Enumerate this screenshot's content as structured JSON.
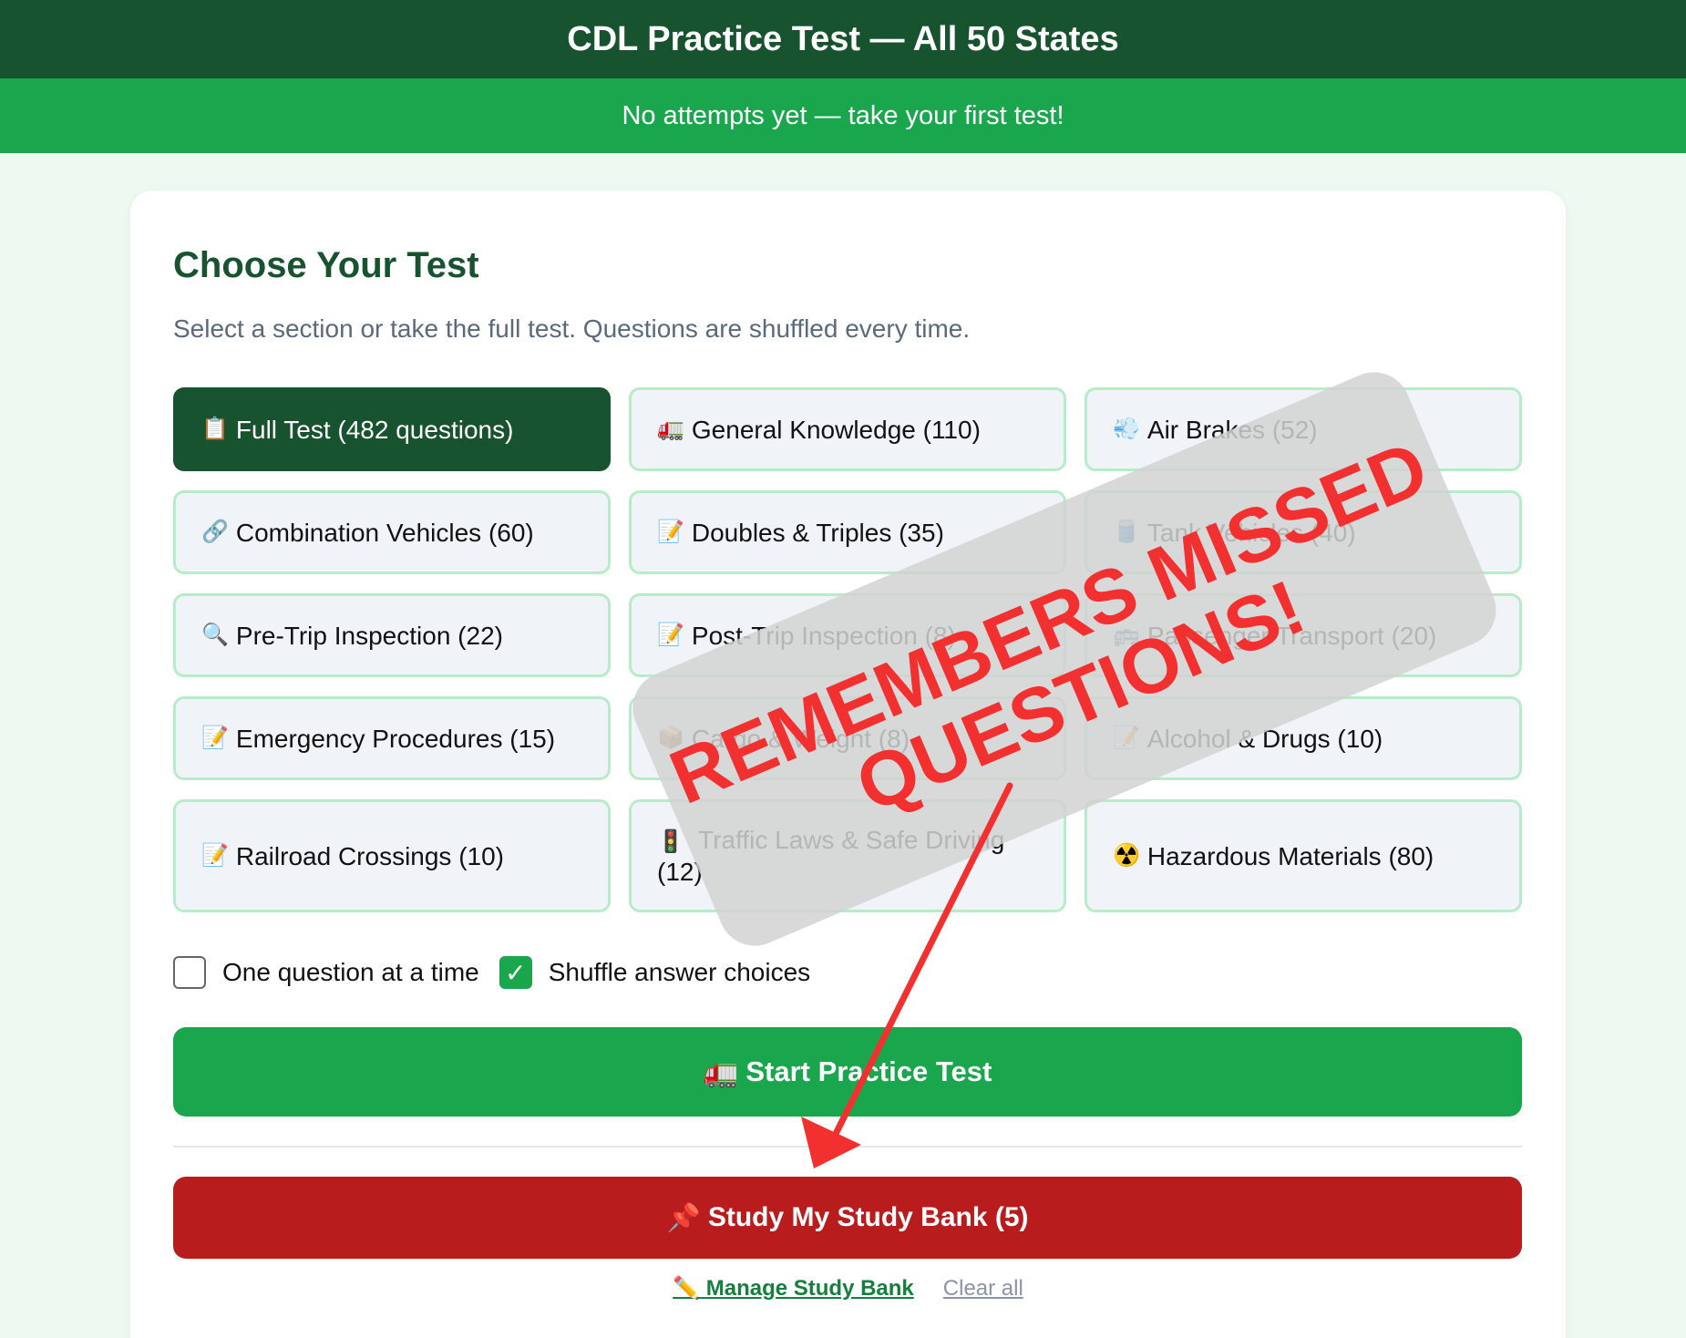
{
  "header": {
    "title": "CDL Practice Test — All 50 States"
  },
  "status": {
    "text": "No attempts yet — take your first test!"
  },
  "main": {
    "heading": "Choose Your Test",
    "subtitle": "Select a section or take the full test. Questions are shuffled every time.",
    "options": [
      {
        "icon": "clipboard-icon",
        "emoji": "📋",
        "label": "Full Test (482 questions)",
        "selected": true
      },
      {
        "icon": "truck-icon",
        "emoji": "🚛",
        "label": "General Knowledge (110)"
      },
      {
        "icon": "wind-icon",
        "emoji": "💨",
        "label": "Air Brakes (52)"
      },
      {
        "icon": "link-icon",
        "emoji": "🔗",
        "label": "Combination Vehicles (60)"
      },
      {
        "icon": "memo-icon",
        "emoji": "📝",
        "label": "Doubles & Triples (35)"
      },
      {
        "icon": "tanker-icon",
        "emoji": "🛢️",
        "label": "Tank Vehicles (40)"
      },
      {
        "icon": "magnifier-icon",
        "emoji": "🔍",
        "label": "Pre-Trip Inspection (22)"
      },
      {
        "icon": "memo-icon",
        "emoji": "📝",
        "label": "Post-Trip Inspection (8)"
      },
      {
        "icon": "bus-icon",
        "emoji": "🚌",
        "label": "Passenger Transport (20)"
      },
      {
        "icon": "memo-icon",
        "emoji": "📝",
        "label": "Emergency Procedures (15)"
      },
      {
        "icon": "package-icon",
        "emoji": "📦",
        "label": "Cargo & Weight (8)"
      },
      {
        "icon": "memo-icon",
        "emoji": "📝",
        "label": "Alcohol & Drugs (10)"
      },
      {
        "icon": "memo-icon",
        "emoji": "📝",
        "label": "Railroad Crossings (10)"
      },
      {
        "icon": "traffic-light-icon",
        "emoji": "🚦",
        "label": "Traffic Laws & Safe Driving (12)"
      },
      {
        "icon": "radioactive-icon",
        "emoji": "☢️",
        "label": "Hazardous Materials (80)"
      }
    ],
    "checkboxes": [
      {
        "label": "One question at a time",
        "checked": false
      },
      {
        "label": "Shuffle answer choices",
        "checked": true
      }
    ],
    "start_button": {
      "emoji": "🚛",
      "label": "Start Practice Test"
    },
    "bank_button": {
      "emoji": "📌",
      "label": "Study My Study Bank (5)"
    },
    "manage_link": {
      "emoji": "✏️",
      "label": "Manage Study Bank"
    },
    "clear_link": "Clear all"
  },
  "annotation": {
    "line1": "REMEMBERS MISSED",
    "line2": "QUESTIONS!",
    "color": "#f23030"
  }
}
